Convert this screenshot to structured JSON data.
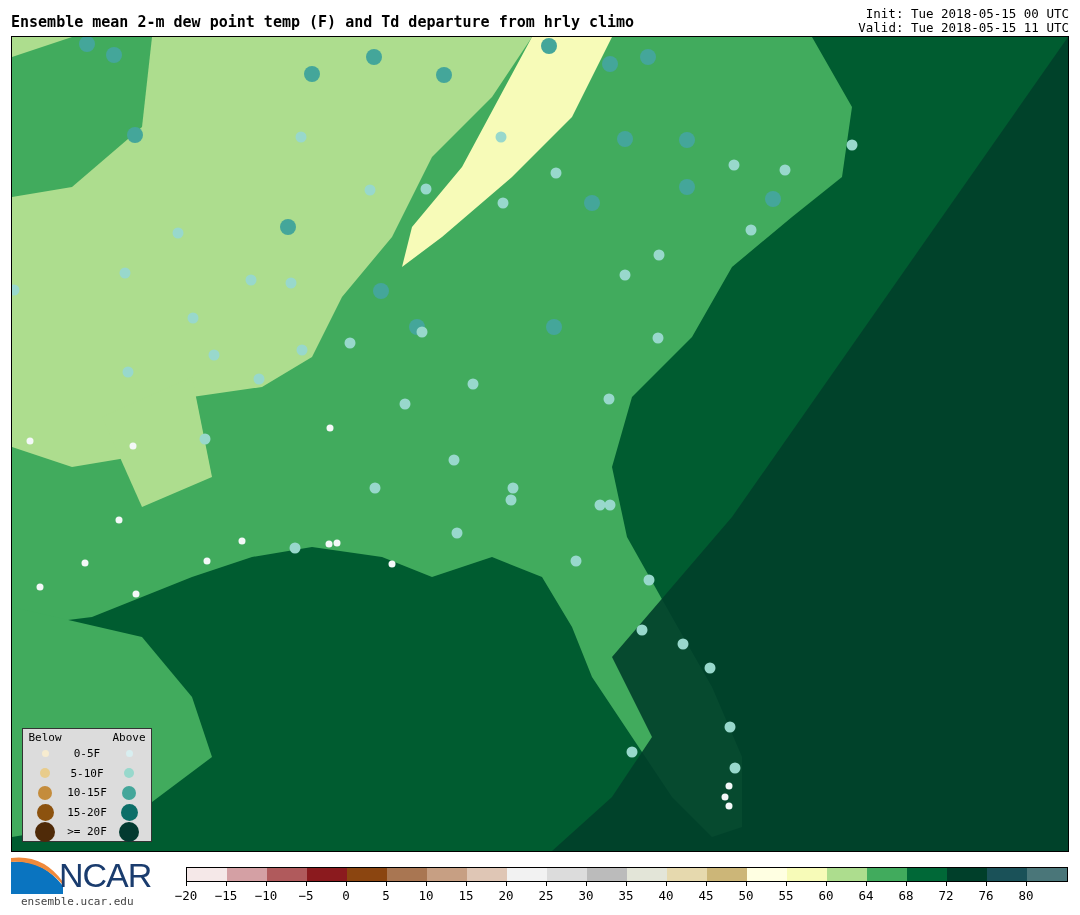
{
  "title": "Ensemble mean 2-m dew point temp (F) and Td departure from hrly climo",
  "init": "Init: Tue 2018-05-15 00 UTC",
  "valid": "Valid: Tue 2018-05-15 11 UTC",
  "legend": {
    "below_heading": "Below",
    "above_heading": "Above",
    "rows": [
      {
        "label": "0-5F",
        "below": {
          "color": "#f7ecd0"
        },
        "above": {
          "color": "#d8eef0"
        }
      },
      {
        "label": "5-10F",
        "below": {
          "color": "#e8cc8c"
        },
        "above": {
          "color": "#98d8cc"
        }
      },
      {
        "label": "10-15F",
        "below": {
          "color": "#c48c3c"
        },
        "above": {
          "color": "#44a69a"
        }
      },
      {
        "label": "15-20F",
        "below": {
          "color": "#8c520f"
        },
        "above": {
          "color": "#0c6e68"
        }
      },
      {
        "label": ">= 20F",
        "below": {
          "color": "#4f2a08"
        },
        "above": {
          "color": "#033a30"
        }
      }
    ]
  },
  "logo": {
    "text": "NCAR",
    "url": "ensemble.ucar.edu"
  },
  "colorbar": {
    "bins": [
      {
        "color": "#f5e8e8",
        "tick": "−20"
      },
      {
        "color": "#d4a0a4",
        "tick": "−15"
      },
      {
        "color": "#b05a5c",
        "tick": "−10"
      },
      {
        "color": "#8b1a1e",
        "tick": "−5"
      },
      {
        "color": "#8b4510",
        "tick": "0"
      },
      {
        "color": "#a97652",
        "tick": "5"
      },
      {
        "color": "#c79f83",
        "tick": "10"
      },
      {
        "color": "#dfc6b5",
        "tick": "15"
      },
      {
        "color": "#f2f2f2",
        "tick": "20"
      },
      {
        "color": "#dcdcdc",
        "tick": "25"
      },
      {
        "color": "#bbbbbb",
        "tick": "30"
      },
      {
        "color": "#e3e5d8",
        "tick": "35"
      },
      {
        "color": "#e6d9ae",
        "tick": "40"
      },
      {
        "color": "#ccb678",
        "tick": "45"
      },
      {
        "color": "#ffffe2",
        "tick": "50"
      },
      {
        "color": "#f7fbb8",
        "tick": "55"
      },
      {
        "color": "#addd8e",
        "tick": "60"
      },
      {
        "color": "#41ab5d",
        "tick": "64"
      },
      {
        "color": "#006837",
        "tick": "68"
      },
      {
        "color": "#003f2a",
        "tick": "72"
      },
      {
        "color": "#1a5158",
        "tick": "76"
      },
      {
        "color": "#4a7679",
        "tick": "80"
      }
    ]
  }
}
